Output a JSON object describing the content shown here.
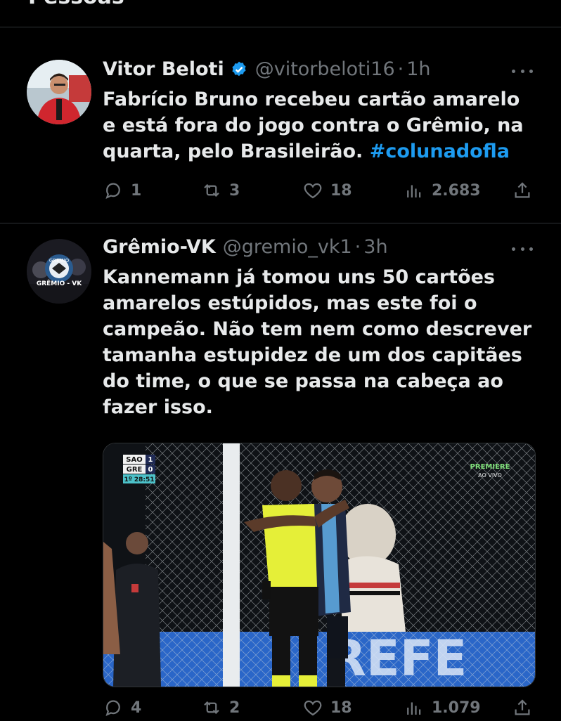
{
  "section_title": "Pessoas",
  "tweets": [
    {
      "name": "Vitor Beloti",
      "handle": "@vitorbeloti16",
      "dot": "·",
      "time": "1h",
      "text": "Fabrício Bruno recebeu cartão amarelo e está fora do jogo contra o Grêmio, na quarta, pelo Brasileirão.",
      "hashtag": "#colunadofla",
      "replies": "1",
      "retweets": "3",
      "likes": "18",
      "views": "2.683"
    },
    {
      "name": "Grêmio-VK",
      "handle": "@gremio_vk1",
      "dot": "·",
      "time": "3h",
      "avatar_text": "GRÊMIO - VK",
      "text": "Kannemann já tomou uns 50 cartões amarelos estúpidos, mas este foi o campeão. Não tem nem como descrever tamanha estupidez de um dos capitães do time, o que se passa na cabeça ao fazer isso.",
      "replies": "4",
      "retweets": "2",
      "likes": "18",
      "views": "1.079",
      "media": {
        "team1": "SAO",
        "score1": "1",
        "team2": "GRE",
        "score2": "0",
        "clock": "1º 28:51",
        "broadcaster": "PREMIERE",
        "live": "AO VIVO"
      }
    }
  ],
  "colors": {
    "background": "#000000",
    "text": "#e7e9ea",
    "muted": "#71767b",
    "link": "#1d9bf0",
    "border": "#2f3336"
  }
}
